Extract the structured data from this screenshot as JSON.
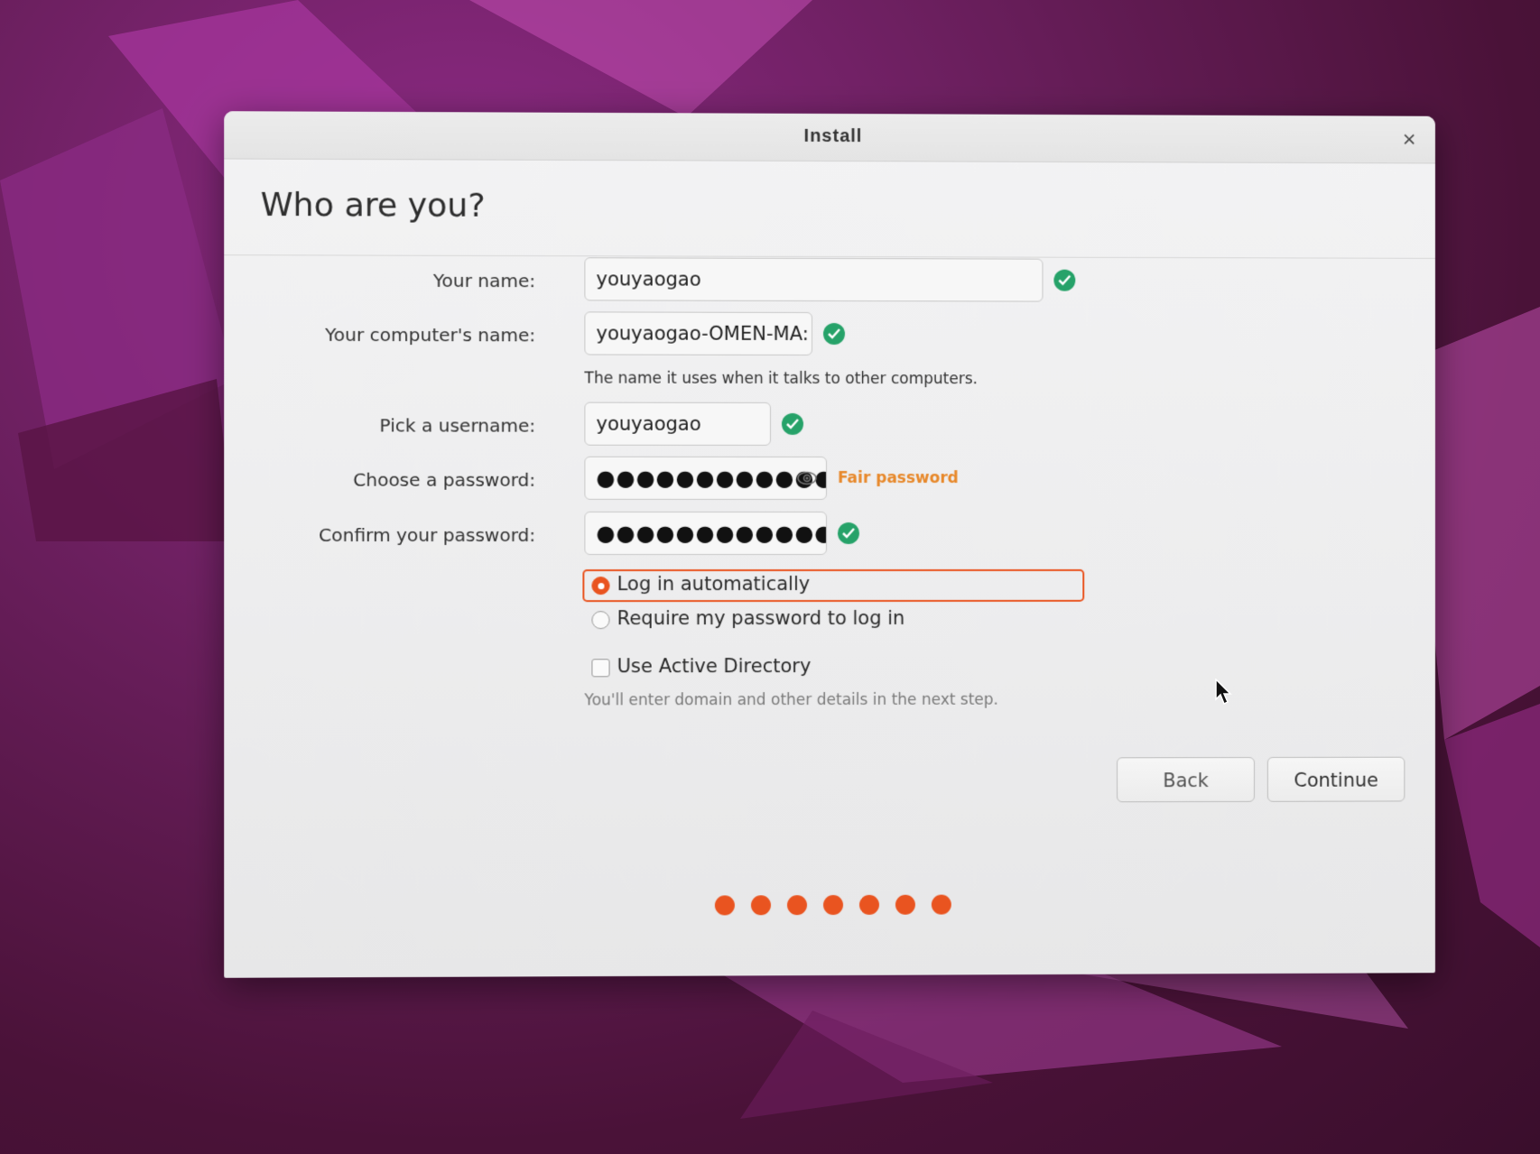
{
  "window": {
    "title": "Install",
    "close_symbol": "×"
  },
  "page": {
    "title": "Who are you?"
  },
  "form": {
    "name": {
      "label": "Your name:",
      "value": "youyaogao",
      "valid": true
    },
    "computer_name": {
      "label": "Your computer's name:",
      "value": "youyaogao-OMEN-MA:",
      "hint": "The name it uses when it talks to other computers.",
      "valid": true
    },
    "username": {
      "label": "Pick a username:",
      "value": "youyaogao",
      "valid": true
    },
    "password": {
      "label": "Choose a password:",
      "masked": "●●●●●●●●●●●●",
      "strength": "Fair password"
    },
    "confirm_password": {
      "label": "Confirm your password:",
      "masked": "●●●●●●●●●●●●●●",
      "valid": true
    },
    "login_options": [
      {
        "label": "Log in automatically",
        "selected": true
      },
      {
        "label": "Require my password to log in",
        "selected": false
      }
    ],
    "active_directory": {
      "label": "Use Active Directory",
      "checked": false,
      "hint": "You'll enter domain and other details in the next step."
    }
  },
  "buttons": {
    "back": "Back",
    "continue": "Continue"
  },
  "progress": {
    "steps": 7,
    "completed": 7
  },
  "colors": {
    "accent": "#e95420",
    "valid": "#26a269",
    "fair": "#e7882a"
  }
}
